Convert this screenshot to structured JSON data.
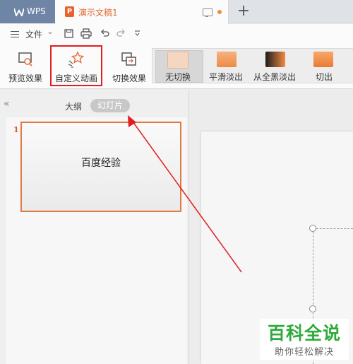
{
  "tabs": {
    "app_name": "WPS",
    "document": "演示文稿1",
    "add": "+"
  },
  "menu": {
    "file": "文件",
    "file_caret": "⌄"
  },
  "ribbon": {
    "preview_effect": "预览效果",
    "custom_animation": "自定义动画",
    "switch_effect": "切换效果",
    "transitions": [
      "无切换",
      "平滑淡出",
      "从全黑淡出",
      "切出"
    ]
  },
  "left_pane": {
    "collapse": "«",
    "outline_tab": "大纲",
    "slides_tab": "幻灯片",
    "slide_number": "1",
    "slide_title": "百度经验"
  },
  "watermark": {
    "title": "百科全说",
    "subtitle": "助你轻松解决"
  },
  "colors": {
    "accent_orange": "#e16a35",
    "highlight_red": "#e02020",
    "watermark_green": "#2eaa3a"
  }
}
